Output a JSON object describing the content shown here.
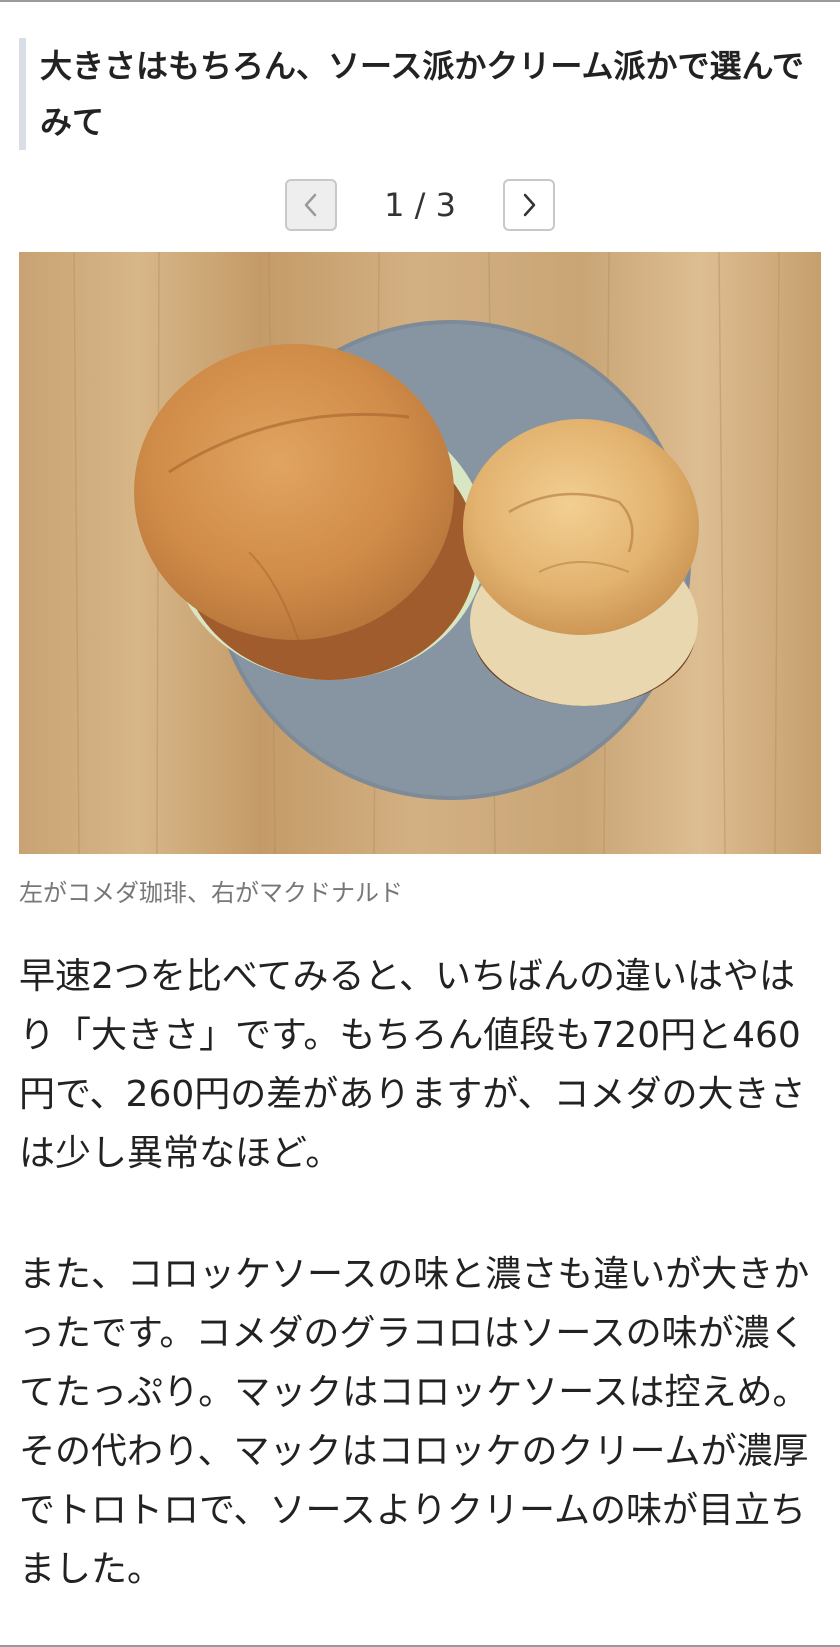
{
  "article": {
    "heading": "大きさはもちろん、ソース派かクリーム派かで選んでみて",
    "pager": {
      "counter": "1 / 3",
      "prev_icon": "chevron-left-icon",
      "next_icon": "chevron-right-icon"
    },
    "photo": {
      "caption": "左がコメダ珈琲、右がマクドナルド"
    },
    "paragraphs": [
      "早速2つを比べてみると、いちばんの違いはやはり「大きさ」です。もちろん値段も720円と460円で、260円の差がありますが、コメダの大きさは少し異常なほど。",
      "また、コロッケソースの味と濃さも違いが大きかったです。コメダのグラコロはソースの味が濃くてたっぷり。マックはコロッケソースは控えめ。その代わり、マックはコロッケのクリームが濃厚でトロトロで、ソースよりクリームの味が目立ちました。"
    ]
  }
}
